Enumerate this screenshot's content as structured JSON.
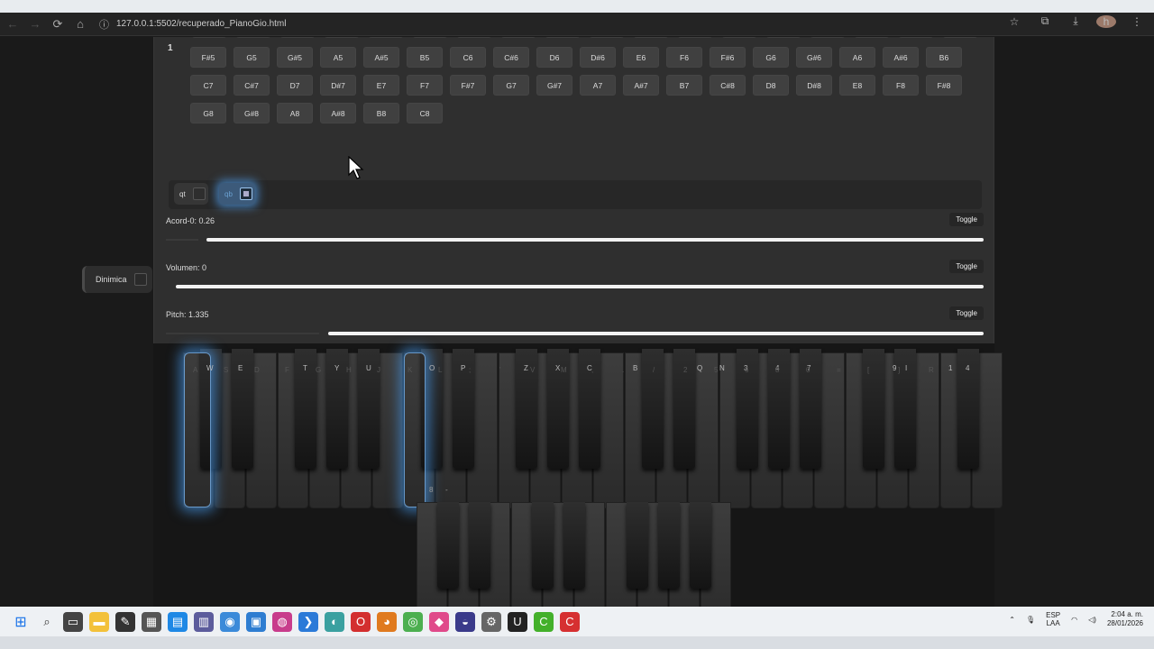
{
  "browser": {
    "url": "127.0.0.1:5502/recuperado_PianoGio.html",
    "back_icon": "←",
    "forward_icon": "→",
    "reload_icon": "⟳",
    "home_icon": "⌂",
    "info_icon": "ⓘ",
    "star_icon": "☆",
    "ext_icon": "⧉",
    "download_icon": "⤓",
    "menu_icon": "⋮",
    "avatar_letter": "h"
  },
  "panel": {
    "row_label": "1",
    "note_rows": [
      [
        "F#5",
        "G5",
        "G#5",
        "A5",
        "A#5",
        "B5",
        "C6",
        "C#6",
        "D6",
        "D#6",
        "E6",
        "F6",
        "F#6",
        "G6",
        "G#6",
        "A6",
        "A#6",
        "B6"
      ],
      [
        "C7",
        "C#7",
        "D7",
        "D#7",
        "E7",
        "F7",
        "F#7",
        "G7",
        "G#7",
        "A7",
        "A#7",
        "B7",
        "C#8",
        "D8",
        "D#8",
        "E8",
        "F8",
        "F#8"
      ],
      [
        "G8",
        "G#8",
        "A8",
        "A#8",
        "B8",
        "C8"
      ]
    ],
    "modes": [
      {
        "label": "qt"
      },
      {
        "label": "qb"
      }
    ],
    "sliders": [
      {
        "label": "Acord-0: 0.26",
        "toggle": "Toggle",
        "value": 0.26
      },
      {
        "label": "Volumen: 0",
        "toggle": "Toggle",
        "value": 0
      },
      {
        "label": "Pitch: 1.335",
        "toggle": "Toggle",
        "value": 1.335
      }
    ],
    "dinamica": "Dinimica"
  },
  "keyboard": {
    "upper_black_labels": [
      "W",
      "E",
      "T",
      "Y",
      "U",
      "O",
      "P",
      "Z",
      "X",
      "C",
      "B",
      "N",
      "Q",
      "3",
      "4",
      "7",
      "9",
      "I",
      "1",
      "4"
    ],
    "upper_dim_labels": [
      "A",
      "S",
      "D",
      "F",
      "G",
      "H",
      "J",
      "K",
      "L",
      ";",
      "'",
      "V",
      "M",
      ",",
      ".",
      "/",
      "2",
      "5",
      "6",
      "8",
      "0",
      "=",
      "[",
      "]",
      "R"
    ],
    "lower_labels": [
      "8",
      "-"
    ]
  },
  "taskbar": {
    "lang_top": "ESP",
    "lang_bottom": "LAA",
    "time": "2:04 a. m.",
    "date": "28/01/2026"
  }
}
